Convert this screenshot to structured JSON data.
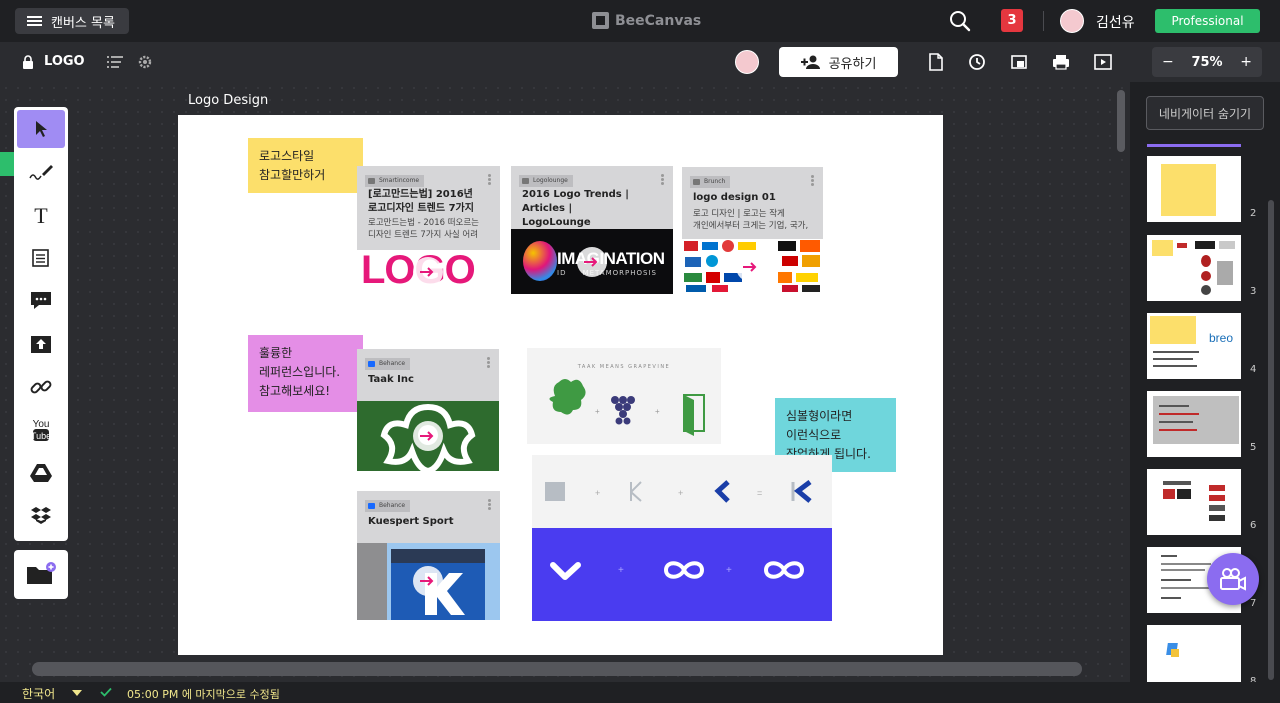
{
  "topbar": {
    "canvas_list_label": "캔버스 목록",
    "brand": "BeeCanvas",
    "notification_count": "3",
    "user_name": "김선유",
    "plan": "Professional"
  },
  "subbar": {
    "canvas_name": "LOGO",
    "share_label": "공유하기",
    "zoom_minus": "−",
    "zoom_value": "75%",
    "zoom_plus": "+"
  },
  "board": {
    "title": "Logo Design",
    "stickies": [
      {
        "text": "로고스타일\n참고할만하거",
        "color": "#fcdf6b"
      },
      {
        "text": "훌륭한\n레퍼런스입니다.\n참고해보세요!",
        "color": "#e48ee6"
      },
      {
        "text": "심볼형이라면\n이런식으로\n작업하게 됩니다.",
        "color": "#6fd6dc"
      }
    ],
    "cards": [
      {
        "source": "Smartincome",
        "title": "[로고만드는법] 2016년\n로고디자인 트렌드 7가지",
        "desc": "로고만드는법 - 2016 떠오르는\n디자인 트렌드 7가지 사실 어려"
      },
      {
        "source": "Logolounge",
        "title": "2016 Logo Trends | Articles |\nLogoLounge",
        "desc": ""
      },
      {
        "source": "Brunch",
        "title": "logo design 01",
        "desc": "로고 디자인 | 로고는 작게\n개인에서부터 크게는 기업, 국가,"
      },
      {
        "source": "Behance",
        "title": "Taak Inc",
        "desc": ""
      },
      {
        "source": "Behance",
        "title": "Kuespert Sport",
        "desc": ""
      }
    ],
    "card_logo_word": "LOGO",
    "card_imagination_word": "IMAGINATION",
    "card_imagination_sub": "ID     METAMORPHOSIS",
    "taak_caption": "TAAK MEANS GRAPEVINE",
    "plus": "+",
    "equals": "="
  },
  "navigator": {
    "hide_label": "네비게이터 숨기기",
    "pages": [
      "2",
      "3",
      "4",
      "5",
      "6",
      "7",
      "8"
    ]
  },
  "statusbar": {
    "language": "한국어",
    "saved_text": "05:00 PM 에 마지막으로 수정됨"
  },
  "colors": {
    "accent_purple": "#a08cf3",
    "brand_green": "#2dbe6c",
    "notif_red": "#e5373f",
    "behance_blue": "#1769ff",
    "block_blue": "#4a3cf0"
  }
}
